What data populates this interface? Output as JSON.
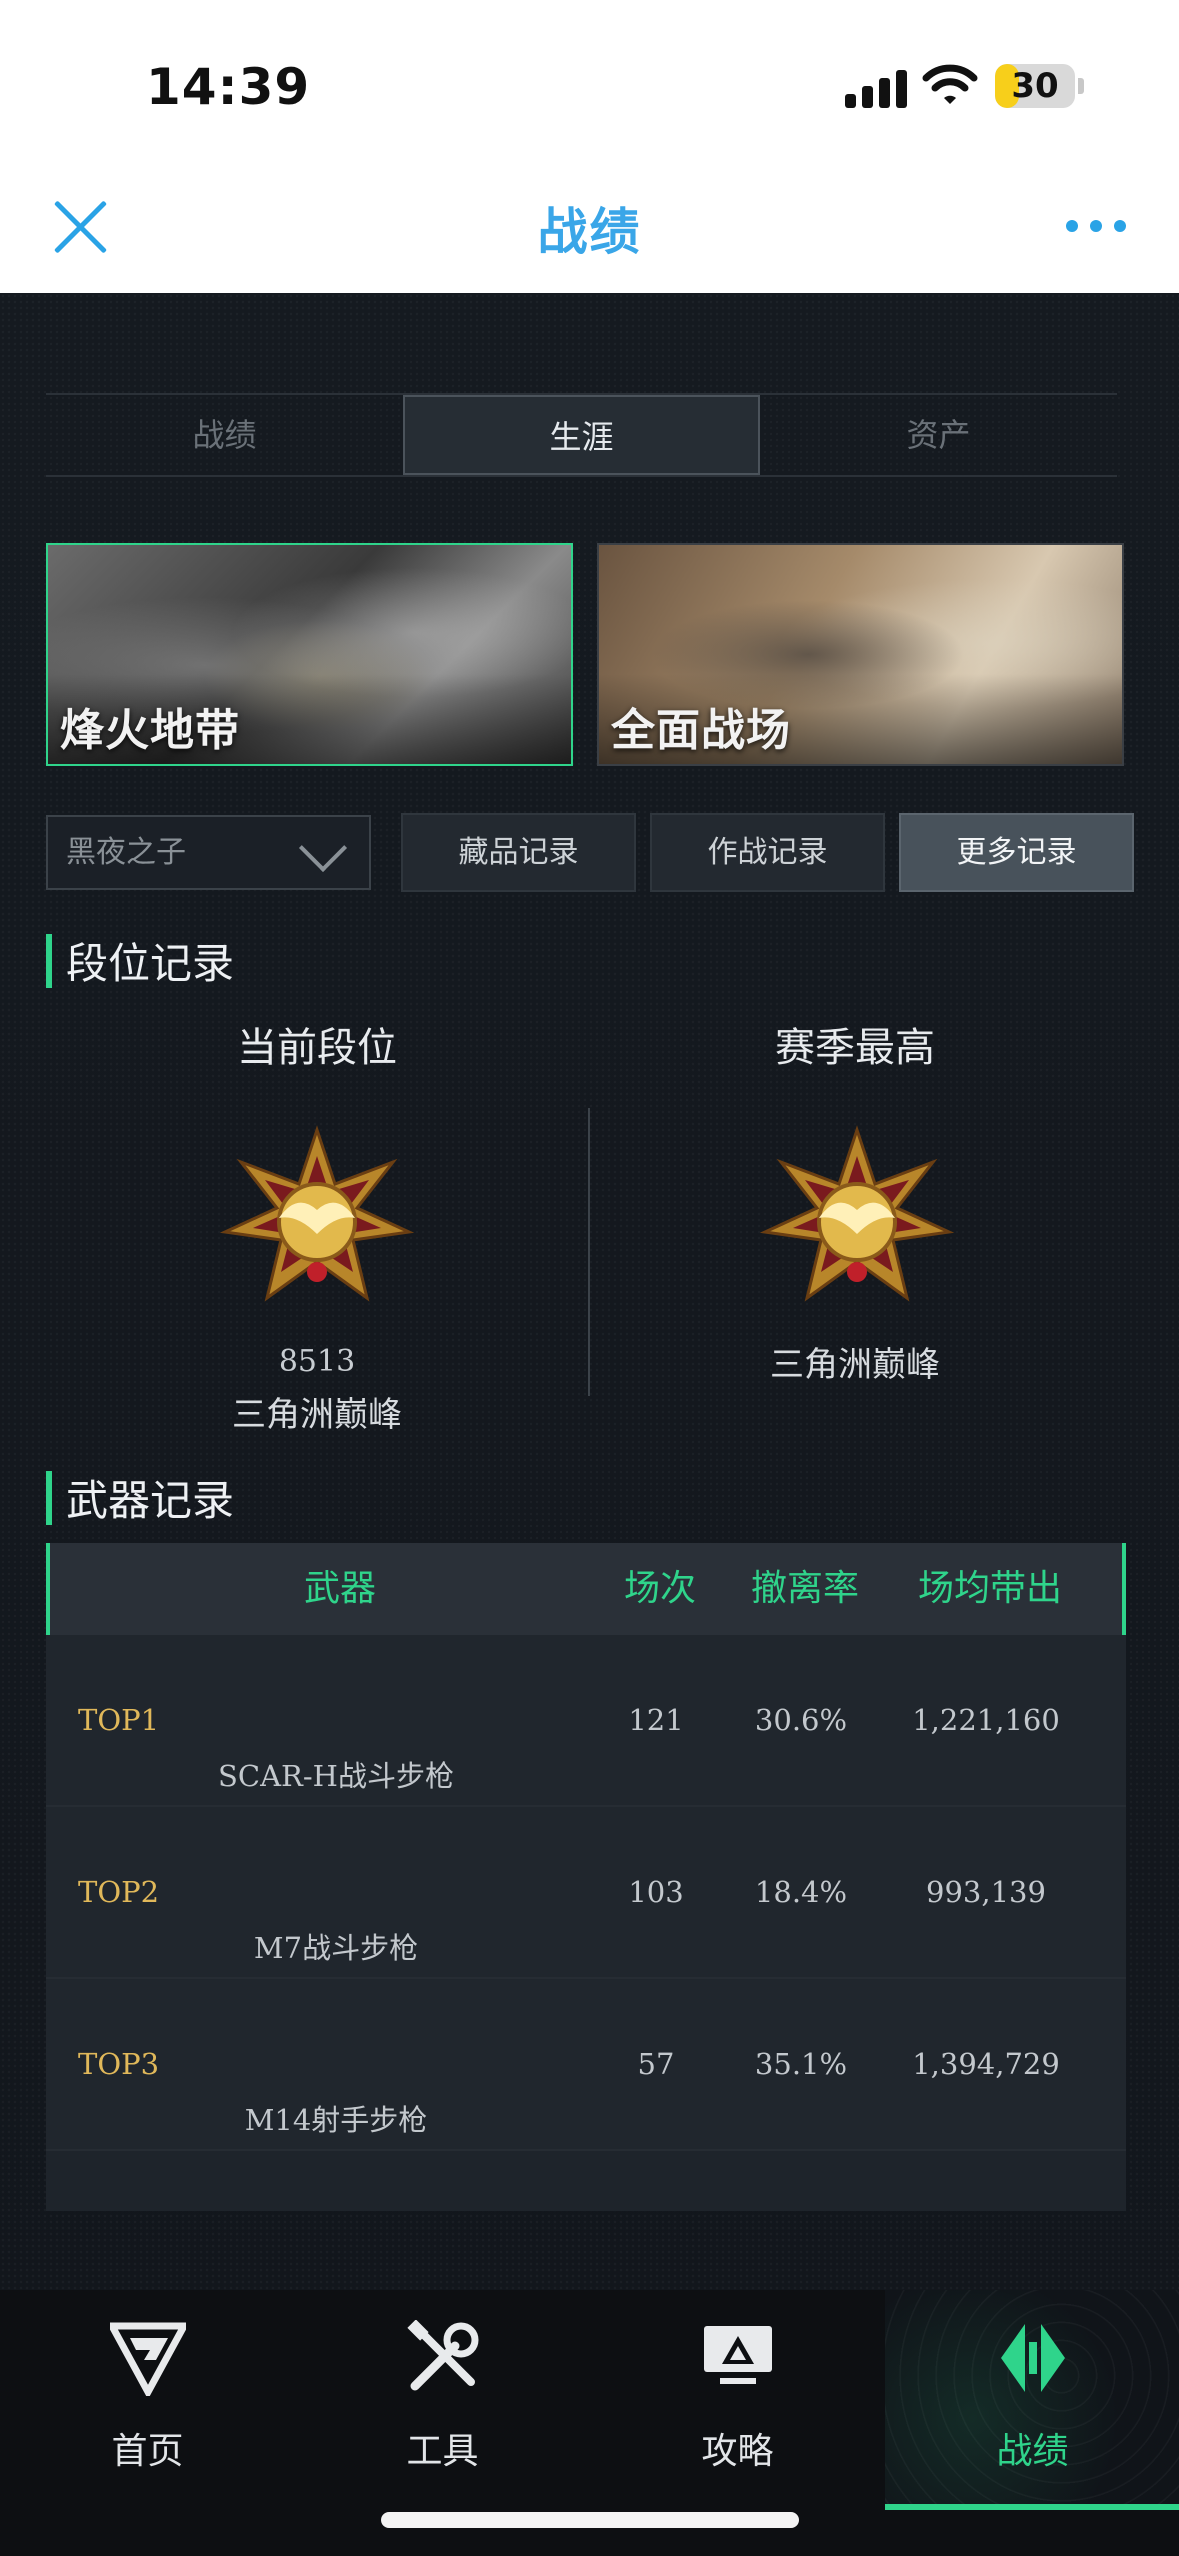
{
  "status_bar": {
    "time": "14:39",
    "battery": "30",
    "battery_level": 0.3
  },
  "header": {
    "title": "战绩"
  },
  "tabs": [
    {
      "label": "战绩",
      "active": false
    },
    {
      "label": "生涯",
      "active": true
    },
    {
      "label": "资产",
      "active": false
    }
  ],
  "modes": [
    {
      "label": "烽火地带",
      "selected": true
    },
    {
      "label": "全面战场",
      "selected": false
    }
  ],
  "filter": {
    "selected": "黑夜之子"
  },
  "record_buttons": [
    {
      "label": "藏品记录",
      "highlighted": false
    },
    {
      "label": "作战记录",
      "highlighted": false
    },
    {
      "label": "更多记录",
      "highlighted": true
    }
  ],
  "rank": {
    "title": "段位记录",
    "current": {
      "heading": "当前段位",
      "score": "8513",
      "name": "三角洲巅峰"
    },
    "season_best": {
      "heading": "赛季最高",
      "name": "三角洲巅峰"
    }
  },
  "weapons": {
    "title": "武器记录",
    "columns": [
      "武器",
      "场次",
      "撤离率",
      "场均带出"
    ],
    "rows": [
      {
        "rank": "TOP1",
        "name": "SCAR-H战斗步枪",
        "matches": "121",
        "extract_rate": "30.6%",
        "avg_loot": "1,221,160"
      },
      {
        "rank": "TOP2",
        "name": "M7战斗步枪",
        "matches": "103",
        "extract_rate": "18.4%",
        "avg_loot": "993,139"
      },
      {
        "rank": "TOP3",
        "name": "M14射手步枪",
        "matches": "57",
        "extract_rate": "35.1%",
        "avg_loot": "1,394,729"
      }
    ]
  },
  "bottom_nav": [
    {
      "label": "首页",
      "icon": "home-logo-icon",
      "active": false
    },
    {
      "label": "工具",
      "icon": "tools-icon",
      "active": false
    },
    {
      "label": "攻略",
      "icon": "guide-monitor-icon",
      "active": false
    },
    {
      "label": "战绩",
      "icon": "record-icon",
      "active": true
    }
  ],
  "colors": {
    "accent": "#2fd48b",
    "header_blue": "#3aa6e8",
    "top_rank_gold": "#e0b85a"
  }
}
